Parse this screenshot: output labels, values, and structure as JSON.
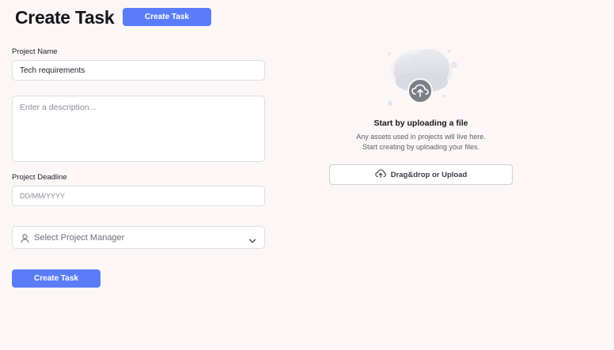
{
  "header": {
    "title": "Create Task",
    "create_button_label": "Create Task"
  },
  "form": {
    "project_name": {
      "label": "Project Name",
      "value": "Tech requirements"
    },
    "description": {
      "placeholder": "Enter a description..."
    },
    "project_deadline": {
      "label": "Project Deadline",
      "placeholder": "DD/MM/YYYY"
    },
    "project_manager": {
      "placeholder": "Select Project Manager",
      "icon": "user-icon"
    },
    "submit_label": "Create Task"
  },
  "upload": {
    "title": "Start by uploading a file",
    "description_line1": "Any assets used in projects will live here.",
    "description_line2": "Start creating by uploading your files.",
    "button_label": "Drag&drop or Upload",
    "icon": "cloud-upload-icon"
  },
  "colors": {
    "accent": "#5b7cfa",
    "background": "#fcf7f6"
  }
}
